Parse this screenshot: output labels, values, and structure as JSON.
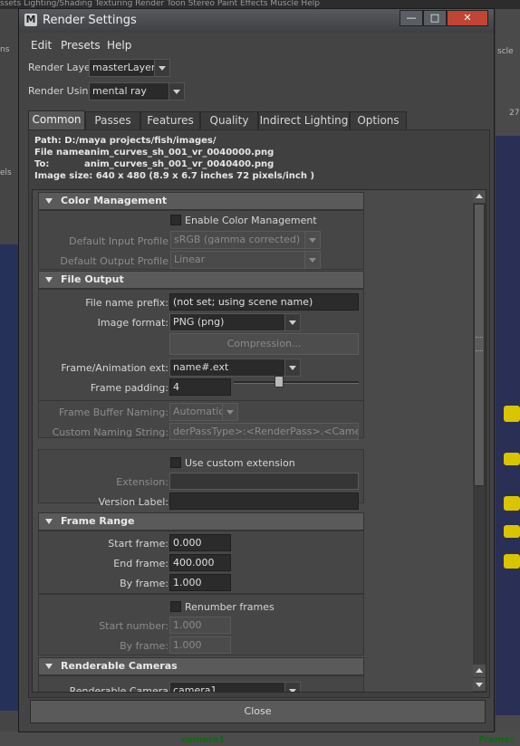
{
  "background": {
    "top_menu": "ssets   Lighting/Shading   Texturing   Render   Toon   Stereo   Paint Effects   Muscle   Help",
    "left_labels": [
      "ns",
      "els"
    ],
    "right_labels": [
      "scle",
      "27"
    ],
    "camera_label": "camera1",
    "frame_label": "Frame:"
  },
  "window": {
    "title": "Render Settings",
    "icon": "maya-app-icon",
    "min_label": "—",
    "max_label": "□",
    "close_label": "✕"
  },
  "menubar": [
    "Edit",
    "Presets",
    "Help"
  ],
  "render_layer": {
    "label": "Render Layer",
    "value": "masterLayer"
  },
  "render_using": {
    "label": "Render Using",
    "value": "mental ray"
  },
  "tabs": [
    {
      "label": "Common",
      "active": true
    },
    {
      "label": "Passes"
    },
    {
      "label": "Features"
    },
    {
      "label": "Quality"
    },
    {
      "label": "Indirect Lighting"
    },
    {
      "label": "Options"
    }
  ],
  "info": {
    "path": "Path: D:/maya projects/fish/images/",
    "file_name_label": "File name:",
    "file_name": "anim_curves_sh_001_vr_0040000.png",
    "to_label": "To:",
    "to": "anim_curves_sh_001_vr_0040400.png",
    "image_size": "Image size: 640 x 480 (8.9 x 6.7 inches 72 pixels/inch )"
  },
  "color_management": {
    "title": "Color Management",
    "enable_label": "Enable Color Management",
    "input_profile_label": "Default Input Profile",
    "input_profile_value": "sRGB (gamma corrected)",
    "output_profile_label": "Default Output Profile",
    "output_profile_value": "Linear"
  },
  "file_output": {
    "title": "File Output",
    "prefix_label": "File name prefix:",
    "prefix_value": "(not set; using scene name)",
    "format_label": "Image format:",
    "format_value": "PNG (png)",
    "compression_label": "Compression...",
    "frame_ext_label": "Frame/Animation ext:",
    "frame_ext_value": "name#.ext",
    "padding_label": "Frame padding:",
    "padding_value": "4",
    "padding_slider": 0.35,
    "fb_naming_label": "Frame Buffer Naming:",
    "fb_naming_value": "Automatic",
    "custom_naming_label": "Custom Naming String:",
    "custom_naming_value": "derPassType>:<RenderPass>.<Camera>",
    "use_custom_ext_label": "Use custom extension",
    "extension_label": "Extension:",
    "version_label": "Version Label:"
  },
  "frame_range": {
    "title": "Frame Range",
    "start_label": "Start frame:",
    "start_value": "0.000",
    "end_label": "End frame:",
    "end_value": "400.000",
    "by_label": "By frame:",
    "by_value": "1.000",
    "renumber_label": "Renumber frames",
    "start_number_label": "Start number:",
    "start_number_value": "1.000",
    "by_frame2_label": "By frame:",
    "by_frame2_value": "1.000"
  },
  "renderable_cameras": {
    "title": "Renderable Cameras",
    "camera_label": "Renderable Camera",
    "camera_value": "camera1"
  },
  "close_button": "Close"
}
